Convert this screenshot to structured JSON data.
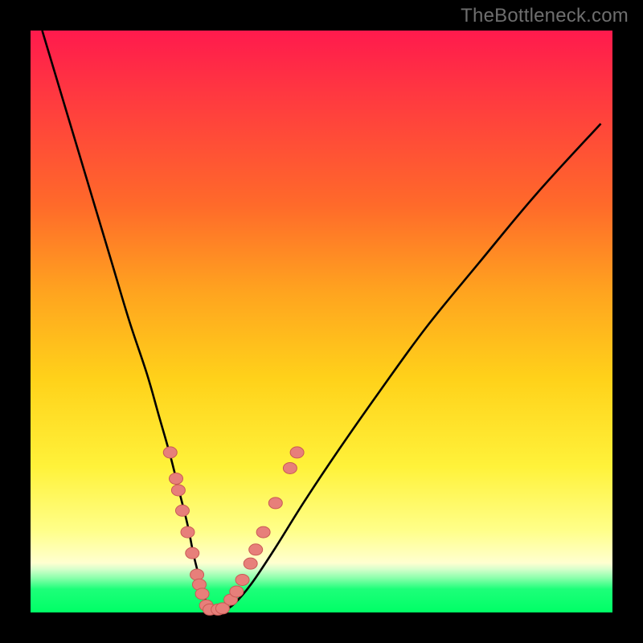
{
  "watermark": "TheBottleneck.com",
  "colors": {
    "background": "#000000",
    "gradient_top": "#ff1a4d",
    "gradient_mid": "#ffd21a",
    "gradient_bottom": "#00ff66",
    "curve": "#000000",
    "dot_fill": "#e77f7a",
    "dot_stroke": "#c95a55"
  },
  "chart_data": {
    "type": "line",
    "title": "",
    "xlabel": "",
    "ylabel": "",
    "xlim": [
      0,
      100
    ],
    "ylim": [
      0,
      100
    ],
    "series": [
      {
        "name": "bottleneck-curve",
        "x": [
          2,
          5,
          8,
          11,
          14,
          17,
          20,
          22,
          24,
          25.5,
          27,
          28,
          29,
          29.8,
          30.5,
          31.5,
          33,
          35,
          38,
          42,
          47,
          53,
          60,
          68,
          77,
          87,
          98
        ],
        "y": [
          100,
          90,
          80,
          70,
          60,
          50,
          41,
          34,
          27,
          21,
          15,
          10,
          6,
          3,
          1,
          0.3,
          0.3,
          1.5,
          5,
          11,
          19,
          28,
          38,
          49,
          60,
          72,
          84
        ]
      }
    ],
    "markers": {
      "name": "highlight-dots",
      "points": [
        {
          "x": 24.0,
          "y": 27.5
        },
        {
          "x": 25.0,
          "y": 23.0
        },
        {
          "x": 25.4,
          "y": 21.0
        },
        {
          "x": 26.1,
          "y": 17.5
        },
        {
          "x": 27.0,
          "y": 13.8
        },
        {
          "x": 27.8,
          "y": 10.2
        },
        {
          "x": 28.6,
          "y": 6.5
        },
        {
          "x": 29.0,
          "y": 4.8
        },
        {
          "x": 29.5,
          "y": 3.2
        },
        {
          "x": 30.2,
          "y": 1.2
        },
        {
          "x": 30.8,
          "y": 0.5
        },
        {
          "x": 32.2,
          "y": 0.5
        },
        {
          "x": 33.0,
          "y": 0.7
        },
        {
          "x": 34.4,
          "y": 2.2
        },
        {
          "x": 35.4,
          "y": 3.6
        },
        {
          "x": 36.4,
          "y": 5.6
        },
        {
          "x": 37.8,
          "y": 8.4
        },
        {
          "x": 38.7,
          "y": 10.8
        },
        {
          "x": 40.0,
          "y": 13.8
        },
        {
          "x": 42.1,
          "y": 18.8
        },
        {
          "x": 44.6,
          "y": 24.8
        },
        {
          "x": 45.8,
          "y": 27.5
        }
      ]
    }
  }
}
